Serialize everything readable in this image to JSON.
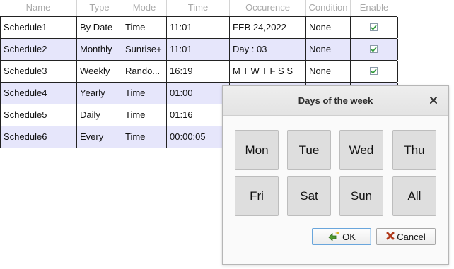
{
  "table": {
    "columns": [
      "Name",
      "Type",
      "Mode",
      "Time",
      "Occurence",
      "Condition",
      "Enable"
    ],
    "rows": [
      {
        "name": "Schedule1",
        "type": "By Date",
        "mode": "Time",
        "time": "11:01",
        "occurence": "FEB 24,2022",
        "condition": "None",
        "enabled": true
      },
      {
        "name": "Schedule2",
        "type": "Monthly",
        "mode": "Sunrise+",
        "time": "11:01",
        "occurence": "Day : 03",
        "condition": "None",
        "enabled": true
      },
      {
        "name": "Schedule3",
        "type": "Weekly",
        "mode": "Rando...",
        "time": "16:19",
        "occurence": "M T W T F S S",
        "condition": "None",
        "enabled": true
      },
      {
        "name": "Schedule4",
        "type": "Yearly",
        "mode": "Time",
        "time": "01:00",
        "occurence": "",
        "condition": "",
        "enabled": false
      },
      {
        "name": "Schedule5",
        "type": "Daily",
        "mode": "Time",
        "time": "01:16",
        "occurence": "",
        "condition": "",
        "enabled": false
      },
      {
        "name": "Schedule6",
        "type": "Every",
        "mode": "Time",
        "time": "00:00:05",
        "occurence": "",
        "condition": "",
        "enabled": false
      }
    ]
  },
  "dialog": {
    "title": "Days of the week",
    "days": [
      "Mon",
      "Tue",
      "Wed",
      "Thu",
      "Fri",
      "Sat",
      "Sun",
      "All"
    ],
    "ok_label": "OK",
    "cancel_label": "Cancel"
  },
  "icons": {
    "checkbox": "checkmark-icon",
    "close": "close-icon",
    "ok": "ok-arrow-icon",
    "cancel": "cancel-x-icon"
  },
  "colors": {
    "alt_row": "#e6e6fb",
    "check": "#2f9a3a",
    "ok_border": "#6aa6dc",
    "cancel_x": "#b03a1c"
  }
}
